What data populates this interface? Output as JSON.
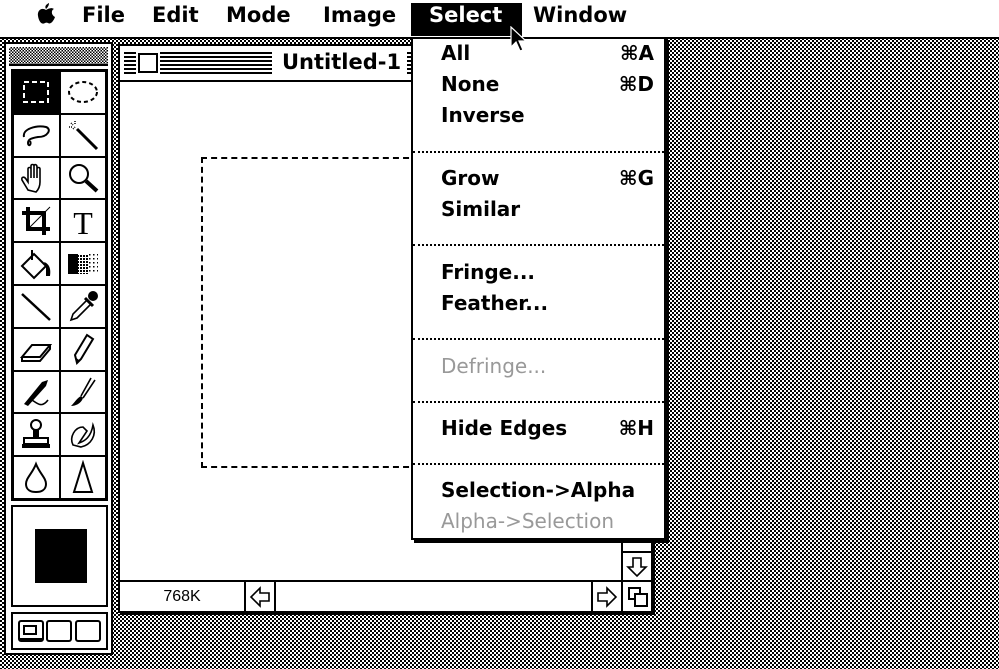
{
  "menubar": {
    "items": [
      {
        "label": "File"
      },
      {
        "label": "Edit"
      },
      {
        "label": "Mode"
      },
      {
        "label": "Image"
      },
      {
        "label": "Select"
      },
      {
        "label": "Window"
      }
    ],
    "active": "Select"
  },
  "document": {
    "title": "Untitled-1",
    "memory": "768K"
  },
  "select_menu": {
    "items": [
      {
        "label": "All",
        "shortcut": "⌘A",
        "enabled": true
      },
      {
        "label": "None",
        "shortcut": "⌘D",
        "enabled": true
      },
      {
        "label": "Inverse",
        "shortcut": "",
        "enabled": true
      },
      {
        "label": "Grow",
        "shortcut": "⌘G",
        "enabled": true
      },
      {
        "label": "Similar",
        "shortcut": "",
        "enabled": true
      },
      {
        "label": "Fringe...",
        "shortcut": "",
        "enabled": true
      },
      {
        "label": "Feather...",
        "shortcut": "",
        "enabled": true
      },
      {
        "label": "Defringe...",
        "shortcut": "",
        "enabled": false
      },
      {
        "label": "Hide Edges",
        "shortcut": "⌘H",
        "enabled": true
      },
      {
        "label": "Selection->Alpha",
        "shortcut": "",
        "enabled": true
      },
      {
        "label": "Alpha->Selection",
        "shortcut": "",
        "enabled": false
      }
    ]
  },
  "tools": [
    "rectangular-marquee",
    "elliptical-marquee",
    "lasso",
    "magic-wand",
    "hand",
    "zoom",
    "crop",
    "type",
    "paint-bucket",
    "gradient",
    "line",
    "eyedropper",
    "eraser",
    "pencil",
    "airbrush",
    "paintbrush",
    "rubber-stamp",
    "smudge",
    "blur",
    "sharpen"
  ],
  "selected_tool": "rectangular-marquee",
  "colors": {
    "foreground": "#000000",
    "background": "#ffffff"
  }
}
